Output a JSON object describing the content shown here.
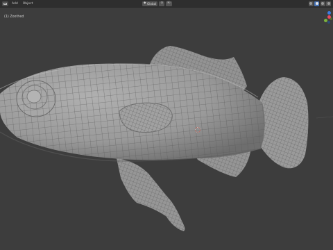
{
  "header": {
    "menus": [
      "Add",
      "Object"
    ],
    "mode_label": "Global",
    "mode_glyph": "◆",
    "pivot_glyph": "⊙",
    "snap_glyph": "⦿"
  },
  "viewport": {
    "overlay_label": "(1) Zoothed"
  },
  "colors": {
    "background": "#3d3d3d",
    "mesh_fill": "#9b9b9b",
    "wire": "#4a4a4a",
    "axis_x": "#e84a5f",
    "axis_y": "#7ab13f",
    "axis_z": "#3c7ce0"
  },
  "icons": [
    "editor-type-icon",
    "global-orientation-icon",
    "pivot-icon",
    "snap-icon",
    "wireframe-shading-icon",
    "solid-shading-icon",
    "material-shading-icon",
    "rendered-shading-icon",
    "3d-cursor-icon",
    "navigation-gizmo-icon"
  ]
}
